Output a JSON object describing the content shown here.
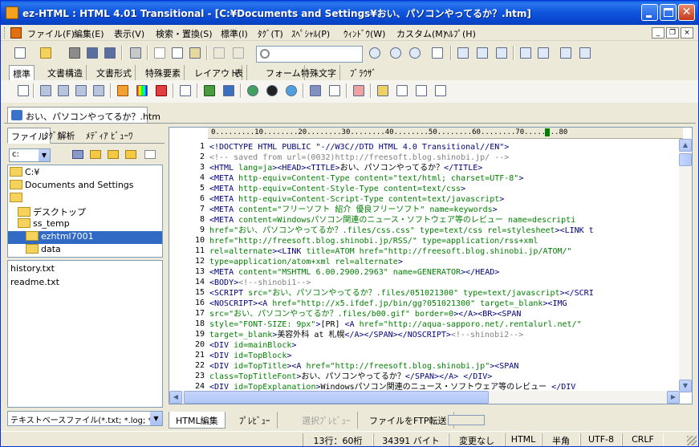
{
  "title": "ez-HTML : HTML 4.01 Transitional - [C:¥Documents and Settings¥おい、パソコンやってるか？.htm]",
  "menu": [
    "ファイル(F)",
    "編集(E)",
    "表示(V)",
    "検索・置換(S)",
    "標準(I)",
    "ﾀｸﾞ(T)",
    "ｽﾍﾟｼｬﾙ(P)",
    "ｳｨﾝﾄﾞｳ(W)",
    "カスタム(M)",
    "ﾍﾙﾌﾟ(H)"
  ],
  "mdi": {
    "min": "_",
    "restore": "❐",
    "close": "×"
  },
  "window_controls": {
    "close": "✕"
  },
  "toolbar_tabs": [
    "標準",
    "文書構造",
    "文書形式",
    "特殊要素",
    "レイアウト",
    "表",
    "フォーム",
    "特殊文字",
    "ﾌﾞﾗｳｻﾞ"
  ],
  "doc_tab": "おい、パソコンやってるか？.htm",
  "left_tabs": [
    "ファイル",
    "ﾀｸﾞ解析",
    "ﾒﾃﾞｨｱ ﾋﾞｭｰﾜ"
  ],
  "drive": "c:",
  "drop_arrow": "▼",
  "tree": [
    {
      "label": "C:¥",
      "depth": 0
    },
    {
      "label": "Documents and Settings",
      "depth": 0
    },
    {
      "label": "",
      "depth": 0
    },
    {
      "label": "デスクトップ",
      "depth": 1
    },
    {
      "label": "ss_temp",
      "depth": 1
    },
    {
      "label": "ezhtml7001",
      "depth": 2,
      "selected": true
    },
    {
      "label": "data",
      "depth": 2
    }
  ],
  "files": [
    "history.txt",
    "readme.txt"
  ],
  "filter": "テキストベースファイル(*.txt; *.log; *.ini;",
  "ruler": "0.........10........20........30........40........50........60........70........80",
  "line_numbers": [
    "1",
    "2",
    "3",
    "4",
    "5",
    "6",
    "7",
    "8",
    "9",
    "10",
    "11",
    "12",
    "13",
    "14",
    "15",
    "16",
    "17",
    "18",
    "19",
    "20",
    "21",
    "22",
    "23",
    "24"
  ],
  "code_lines": [
    [
      [
        "t",
        "<!DOCTYPE HTML PUBLIC \"-//W3C//DTD HTML 4.0 Transitional//EN\">"
      ]
    ],
    [
      [
        "c",
        "<!-- saved from url=(0032)http://freesoft.blog.shinobi.jp/ -->"
      ]
    ],
    [
      [
        "t",
        "<HTML "
      ],
      [
        "a",
        "lang=ja"
      ],
      [
        "t",
        ">"
      ],
      [
        "t",
        "<HEAD>"
      ],
      [
        "t",
        "<TITLE>"
      ],
      [
        "x",
        "おい、パソコンやってるか？"
      ],
      [
        "t",
        "</TITLE>"
      ]
    ],
    [
      [
        "t",
        "<META "
      ],
      [
        "a",
        "http-equiv=Content-Type content=\"text/html; charset=UTF-8\""
      ],
      [
        "t",
        ">"
      ]
    ],
    [
      [
        "t",
        "<META "
      ],
      [
        "a",
        "http-equiv=Content-Style-Type content=text/css"
      ],
      [
        "t",
        ">"
      ]
    ],
    [
      [
        "t",
        "<META "
      ],
      [
        "a",
        "http-equiv=Content-Script-Type content=text/javascript"
      ],
      [
        "t",
        ">"
      ]
    ],
    [
      [
        "t",
        "<META "
      ],
      [
        "a",
        "content=\"フリーソフト 紹介 優良フリーソフト\" name=keywords"
      ],
      [
        "t",
        ">"
      ]
    ],
    [
      [
        "t",
        "<META "
      ],
      [
        "a",
        "content=Windowsパソコン関連のニュース・ソフトウェア等のレビュー name=descripti"
      ]
    ],
    [
      [
        "a",
        "href=\"おい、パソコンやってるか？.files/css.css\" type=text/css rel=stylesheet"
      ],
      [
        "t",
        ">"
      ],
      [
        "t",
        "<LINK t"
      ]
    ],
    [
      [
        "a",
        "href=\"http://freesoft.blog.shinobi.jp/RSS/\" type=application/rss+xml"
      ]
    ],
    [
      [
        "a",
        "rel=alternate"
      ],
      [
        "t",
        ">"
      ],
      [
        "t",
        "<LINK "
      ],
      [
        "a",
        "title=ATOM href=\"http://freesoft.blog.shinobi.jp/ATOM/\""
      ]
    ],
    [
      [
        "a",
        "type=application/atom+xml rel=alternate"
      ],
      [
        "t",
        ">"
      ]
    ],
    [
      [
        "t",
        "<META "
      ],
      [
        "a",
        "content=\"MSHTML 6.00.2900.2963\" name=GENERATOR"
      ],
      [
        "t",
        ">"
      ],
      [
        "t",
        "</HEAD>"
      ]
    ],
    [
      [
        "t",
        "<BODY>"
      ],
      [
        "c",
        "<!--shinobi1-->"
      ]
    ],
    [
      [
        "t",
        "<SCRIPT "
      ],
      [
        "a",
        "src=\"おい、パソコンやってるか？.files/051021300\" type=text/javascript"
      ],
      [
        "t",
        ">"
      ],
      [
        "t",
        "</SCRI"
      ]
    ],
    [
      [
        "t",
        "<NOSCRIPT>"
      ],
      [
        "t",
        "<A "
      ],
      [
        "a",
        "href=\"http://x5.ifdef.jp/bin/gg?051021300\" target=_blank"
      ],
      [
        "t",
        ">"
      ],
      [
        "t",
        "<IMG"
      ]
    ],
    [
      [
        "a",
        "src=\"おい、パソコンやってるか？.files/b00.gif\" border=0"
      ],
      [
        "t",
        ">"
      ],
      [
        "t",
        "</A>"
      ],
      [
        "t",
        "<BR>"
      ],
      [
        "t",
        "<SPAN"
      ]
    ],
    [
      [
        "a",
        "style=\"FONT-SIZE: 9px\""
      ],
      [
        "t",
        ">"
      ],
      [
        "x",
        "[PR] "
      ],
      [
        "t",
        "<A "
      ],
      [
        "a",
        "href=\"http://aqua-sapporo.net/.rentalurl.net/\""
      ]
    ],
    [
      [
        "a",
        "target=_blank"
      ],
      [
        "t",
        ">"
      ],
      [
        "x",
        "美容外科 at 札幌"
      ],
      [
        "t",
        "</A>"
      ],
      [
        "t",
        "</SPAN>"
      ],
      [
        "t",
        "</NOSCRIPT>"
      ],
      [
        "c",
        "<!--shinobi2-->"
      ]
    ],
    [
      [
        "t",
        "<DIV "
      ],
      [
        "a",
        "id=mainBlock"
      ],
      [
        "t",
        ">"
      ]
    ],
    [
      [
        "t",
        "<DIV "
      ],
      [
        "a",
        "id=TopBlock"
      ],
      [
        "t",
        ">"
      ]
    ],
    [
      [
        "t",
        "<DIV "
      ],
      [
        "a",
        "id=TopTitle"
      ],
      [
        "t",
        ">"
      ],
      [
        "t",
        "<A "
      ],
      [
        "a",
        "href=\"http://freesoft.blog.shinobi.jp\""
      ],
      [
        "t",
        ">"
      ],
      [
        "t",
        "<SPAN"
      ]
    ],
    [
      [
        "a",
        "class=TopTitleFont"
      ],
      [
        "t",
        ">"
      ],
      [
        "x",
        "おい、パソコンやってるか？"
      ],
      [
        "t",
        "</SPAN>"
      ],
      [
        "t",
        "</A>"
      ],
      [
        "x",
        " "
      ],
      [
        "t",
        "</DIV>"
      ]
    ],
    [
      [
        "t",
        "<DIV "
      ],
      [
        "a",
        "id=TopExplanation"
      ],
      [
        "t",
        ">"
      ],
      [
        "x",
        "Windowsパソコン関連のニュース・ソフトウェア等のレビュー "
      ],
      [
        "t",
        "</DIV"
      ]
    ]
  ],
  "scroll_arrows": {
    "up": "▲",
    "down": "▼",
    "left": "◀",
    "right": "▶"
  },
  "bottom_tabs": [
    "HTML編集",
    "ﾌﾟﾚﾋﾞｭｰ",
    "選択ﾌﾟﾚﾋﾞｭｰ",
    "ファイルをFTP転送"
  ],
  "status": {
    "position": "13行：60桁",
    "size": "34391 バイト",
    "modified": "変更なし",
    "mode": "HTML",
    "width": "半角",
    "encoding": "UTF-8",
    "newline": "CRLF"
  }
}
